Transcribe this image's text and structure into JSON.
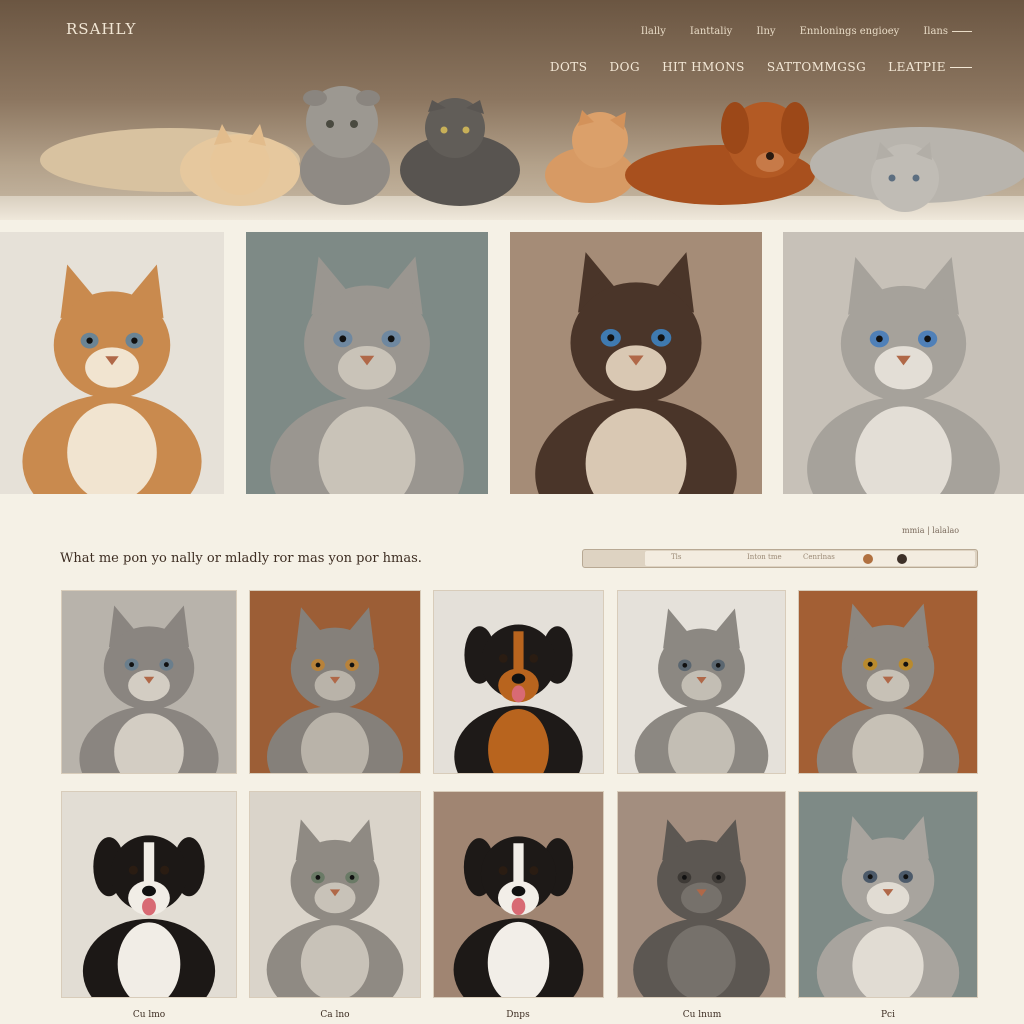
{
  "header": {
    "logo": "RSAHLY",
    "top_links": [
      "Ilally",
      "Ianttaliy",
      "Ilny",
      "Ennlonings engioey",
      "Ilans"
    ],
    "main_nav": [
      "DOTS",
      "DOG",
      "HIT HMONS",
      "SATTOMMGSG",
      "LEATPIE"
    ]
  },
  "filter": {
    "meta": "mmia | lalalao",
    "tagline": "What me pon yo nally or mladly ror mas yon por hmas.",
    "labels": [
      "Tls",
      "Inton tme",
      "Cenrlnas"
    ],
    "dot_colors": [
      "#b07040",
      "#3d3028"
    ]
  },
  "captions": [
    "Cu lmo",
    "Ca lno",
    "Dnps",
    "Cu lnum",
    "Pci"
  ],
  "colors": {
    "hero_dark": "#6b5642",
    "page_bg": "#f5f1e6",
    "accent_rust": "#9c5e36",
    "accent_teal": "#7e8a86"
  },
  "featured_pets": [
    {
      "species": "cat",
      "bg": "#e6e1d8",
      "fur": "#c98a4e",
      "chest": "#f1e4d0",
      "eye": "#6b8494"
    },
    {
      "species": "cat",
      "bg": "#7e8a86",
      "fur": "#9a9690",
      "chest": "#c9c3b8",
      "eye": "#6f88a0"
    },
    {
      "species": "cat",
      "bg": "#a58c77",
      "fur": "#4a3529",
      "chest": "#d9c8b3",
      "eye": "#3f7ab0"
    },
    {
      "species": "cat",
      "bg": "#c7c1b8",
      "fur": "#a6a29b",
      "chest": "#e3ded6",
      "eye": "#4f80b8"
    }
  ],
  "grid_pets": [
    {
      "species": "cat",
      "bg": "#b8b3ab",
      "fur": "#8a8580",
      "chest": "#d3cdc3",
      "eye": "#6a7e8c"
    },
    {
      "species": "cat",
      "bg": "#9c5e36",
      "fur": "#85807a",
      "chest": "#b9b3a9",
      "eye": "#b8823a"
    },
    {
      "species": "dog",
      "bg": "#e4e0d9",
      "fur": "#1e1a18",
      "chest": "#b8641e",
      "eye": "#2a1c12"
    },
    {
      "species": "cat",
      "bg": "#e5e1da",
      "fur": "#8c8882",
      "chest": "#c3beb4",
      "eye": "#5a6670"
    },
    {
      "species": "cat",
      "bg": "#a35f34",
      "fur": "#8d8780",
      "chest": "#c7c1b6",
      "eye": "#b88a2e"
    },
    {
      "species": "dog",
      "bg": "#e2ddd4",
      "fur": "#1c1816",
      "chest": "#f1ede6",
      "eye": "#2a1c12"
    },
    {
      "species": "cat",
      "bg": "#dad4ca",
      "fur": "#8f8a83",
      "chest": "#c8c2b8",
      "eye": "#6a7a66"
    },
    {
      "species": "dog",
      "bg": "#a08572",
      "fur": "#1d1917",
      "chest": "#f2eee8",
      "eye": "#2a1c12"
    },
    {
      "species": "cat",
      "bg": "#a38e7f",
      "fur": "#5c5752",
      "chest": "#76716b",
      "eye": "#3e3a36"
    },
    {
      "species": "cat",
      "bg": "#7e8a86",
      "fur": "#a8a49e",
      "chest": "#e1dcd3",
      "eye": "#4c5a6a"
    }
  ]
}
